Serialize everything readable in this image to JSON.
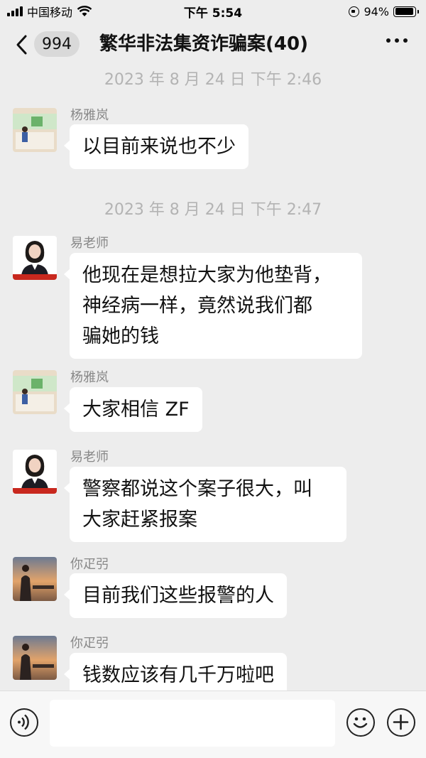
{
  "status_bar": {
    "carrier": "中国移动",
    "time": "下午 5:54",
    "battery": "94%",
    "battery_level": 0.94
  },
  "header": {
    "back_count": "994",
    "title": "繁华非法集资诈骗案(40)"
  },
  "messages": [
    {
      "type": "time",
      "text": "2023 年 8 月 24 日 下午 2:46"
    },
    {
      "type": "msg",
      "sender": "杨雅岚",
      "avatar": "classroom-photo",
      "lines": [
        "以目前来说也不少"
      ]
    },
    {
      "type": "time",
      "text": "2023 年 8 月 24 日 下午 2:47"
    },
    {
      "type": "msg",
      "sender": "易老师",
      "avatar": "woman-portrait",
      "lines": [
        "他现在是想拉大家为他垫背，",
        "神经病一样，竟然说我们都",
        "骗她的钱"
      ]
    },
    {
      "type": "msg",
      "sender": "杨雅岚",
      "avatar": "classroom-photo",
      "lines": [
        "大家相信 ZF"
      ]
    },
    {
      "type": "msg",
      "sender": "易老师",
      "avatar": "woman-portrait",
      "lines": [
        "警察都说这个案子很大，叫",
        "大家赶紧报案"
      ]
    },
    {
      "type": "msg",
      "sender": "你疋弜",
      "avatar": "sunset-photo",
      "lines": [
        "目前我们这些报警的人"
      ]
    },
    {
      "type": "msg",
      "sender": "你疋弜",
      "avatar": "sunset-photo",
      "lines": [
        "钱数应该有几千万啦吧"
      ]
    }
  ],
  "input": {
    "placeholder": ""
  },
  "icons": {
    "back": "chevron-left-icon",
    "more": "more-dots-icon",
    "voice": "voice-icon",
    "emoji": "emoji-icon",
    "plus": "plus-icon"
  }
}
